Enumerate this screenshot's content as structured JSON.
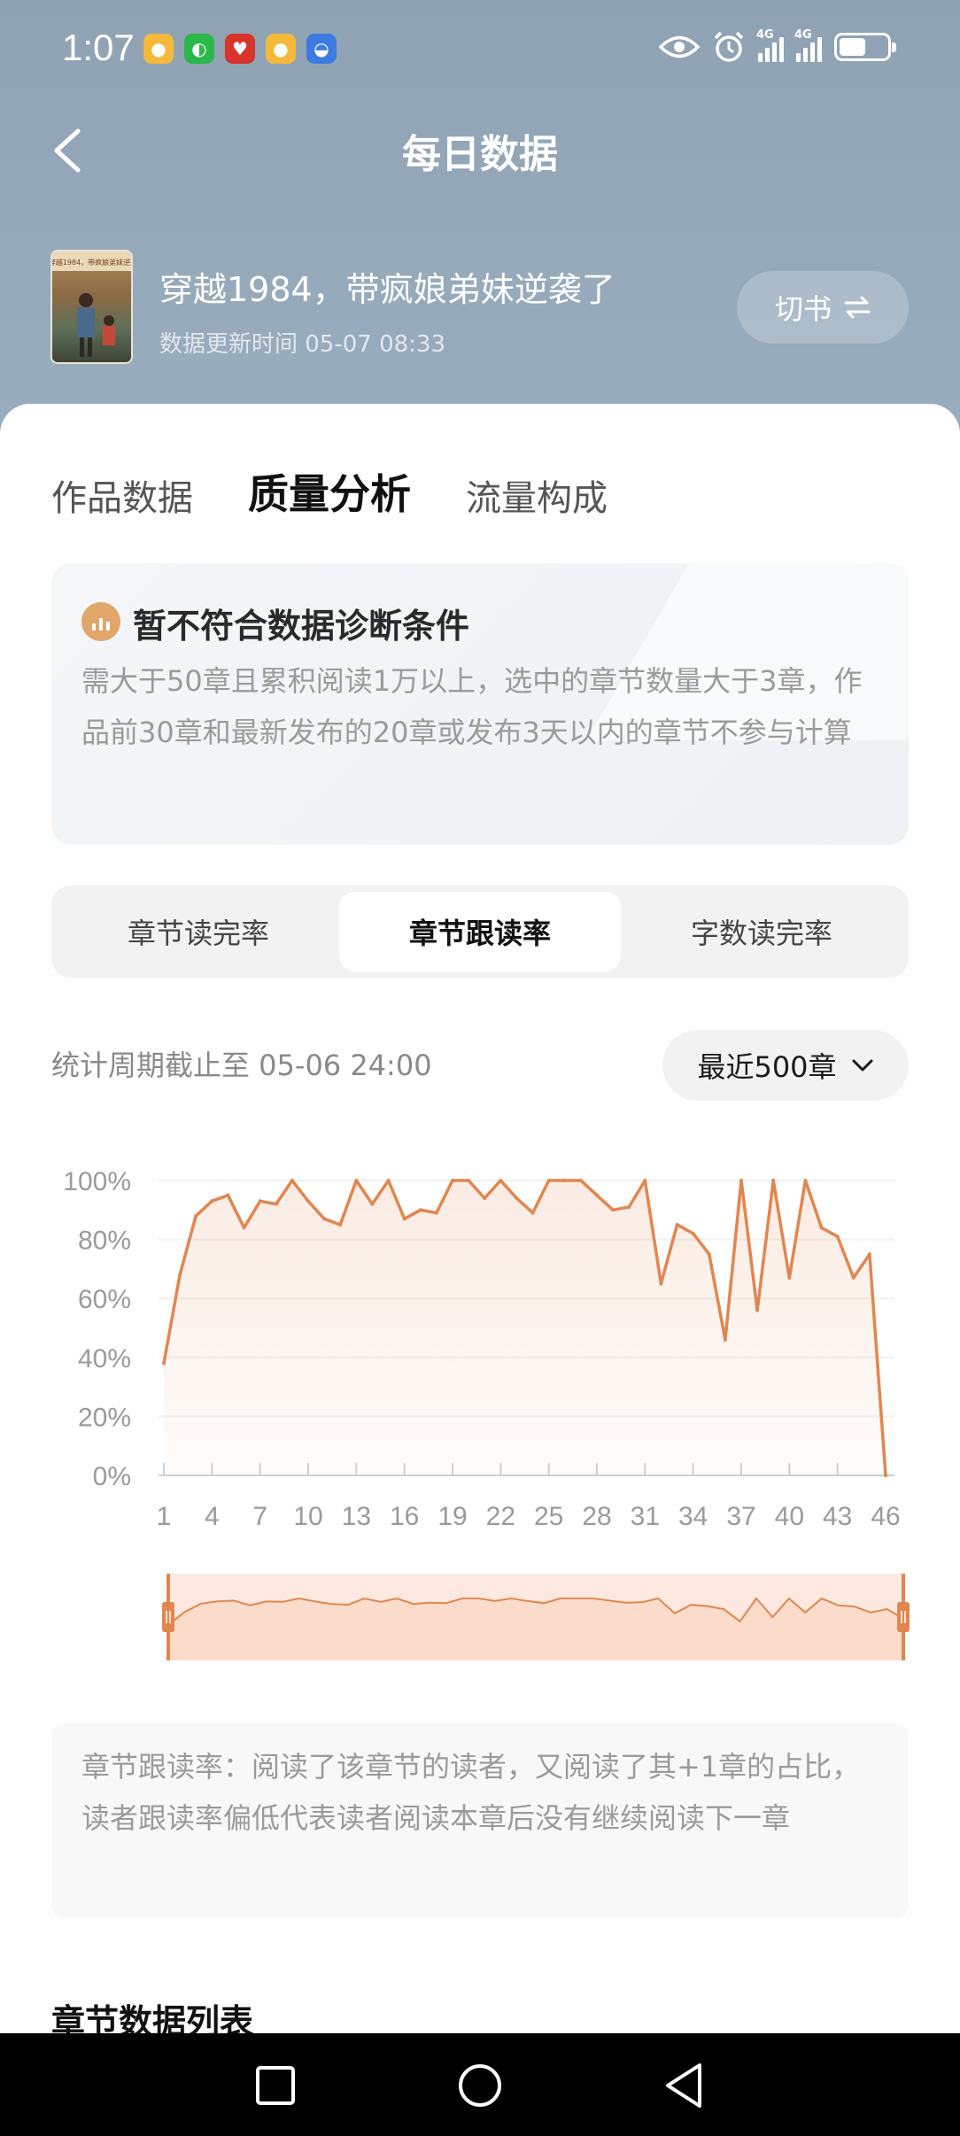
{
  "status_bar": {
    "time": "1:07",
    "notifications": [
      "weibo-icon",
      "wechat-icon",
      "app-icon",
      "weibo-icon",
      "app-icon"
    ],
    "network_1": "4G",
    "network_2": "4G",
    "battery_level": 0.55
  },
  "header": {
    "title": "每日数据"
  },
  "book": {
    "title": "穿越1984，带疯娘弟妹逆袭了",
    "update_time": "数据更新时间 05-07 08:33",
    "switch_label": "切书",
    "cover_text": "穿越1984，带疯娘弟妹逆袭"
  },
  "tabs": [
    {
      "label": "作品数据",
      "active": false
    },
    {
      "label": "质量分析",
      "active": true
    },
    {
      "label": "流量构成",
      "active": false
    }
  ],
  "diagnosis": {
    "title": "暂不符合数据诊断条件",
    "description": "需大于50章且累积阅读1万以上，选中的章节数量大于3章，作品前30章和最新发布的20章或发布3天以内的章节不参与计算"
  },
  "segments": [
    {
      "label": "章节读完率",
      "active": false
    },
    {
      "label": "章节跟读率",
      "active": true
    },
    {
      "label": "字数读完率",
      "active": false
    }
  ],
  "period": {
    "label": "统计周期截止至 05-06 24:00",
    "range_label": "最近500章"
  },
  "chart_data": {
    "type": "area",
    "title": "",
    "xlabel": "",
    "ylabel": "",
    "x_tick_labels": [
      "1",
      "4",
      "7",
      "10",
      "13",
      "16",
      "19",
      "22",
      "25",
      "28",
      "31",
      "34",
      "37",
      "40",
      "43",
      "46"
    ],
    "y_tick_labels": [
      "0%",
      "20%",
      "40%",
      "60%",
      "80%",
      "100%"
    ],
    "ylim": [
      0,
      100
    ],
    "x": [
      1,
      2,
      3,
      4,
      5,
      6,
      7,
      8,
      9,
      10,
      11,
      12,
      13,
      14,
      15,
      16,
      17,
      18,
      19,
      20,
      21,
      22,
      23,
      24,
      25,
      26,
      27,
      28,
      29,
      30,
      31,
      32,
      33,
      34,
      35,
      36,
      37,
      38,
      39,
      40,
      41,
      42,
      43,
      44,
      45,
      46
    ],
    "series": [
      {
        "values": [
          38,
          68,
          88,
          93,
          95,
          84,
          93,
          92,
          100,
          93,
          87,
          85,
          100,
          92,
          100,
          87,
          90,
          89,
          100,
          100,
          94,
          100,
          94,
          89,
          100,
          100,
          100,
          95,
          90,
          91,
          100,
          65,
          85,
          82,
          75,
          46,
          100,
          56,
          100,
          67,
          100,
          84,
          81,
          67,
          75,
          0
        ]
      }
    ],
    "grid": true,
    "line_color": "#e2864f",
    "fill_color": "#fde9df",
    "has_range_navigator": true
  },
  "note": {
    "text": "章节跟读率：阅读了该章节的读者，又阅读了其+1章的占比，读者跟读率偏低代表读者阅读本章后没有继续阅读下一章"
  },
  "list": {
    "title": "章节数据列表"
  }
}
